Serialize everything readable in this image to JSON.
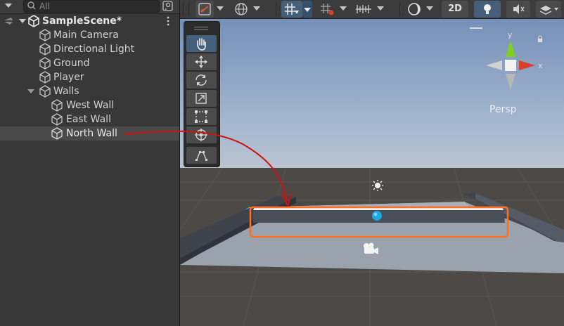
{
  "hierarchy": {
    "search_placeholder": "All",
    "scene_name": "SampleScene*",
    "items": [
      {
        "label": "Main Camera"
      },
      {
        "label": "Directional Light"
      },
      {
        "label": "Ground"
      },
      {
        "label": "Player"
      },
      {
        "label": "Walls"
      },
      {
        "label": "West Wall"
      },
      {
        "label": "East Wall"
      },
      {
        "label": "North Wall"
      }
    ],
    "selected": "North Wall"
  },
  "scene_toolbar": {
    "mode_2d": "2D"
  },
  "scene_view": {
    "projection_label": "Persp",
    "axis_y": "y",
    "axis_x": "x"
  },
  "colors": {
    "selection_outline": "#ff6f1f",
    "annotation_arrow": "#d11010",
    "gizmo_y": "#7fd11a",
    "gizmo_x": "#d8402a",
    "player": "#1ea7e0"
  },
  "icons": [
    "hand-icon",
    "move-icon",
    "rotate-icon",
    "scale-icon",
    "rect-icon",
    "transform-icon",
    "custom-tool-icon",
    "gizmo-icon",
    "grid-snap-icon",
    "light-icon",
    "audio-icon"
  ]
}
